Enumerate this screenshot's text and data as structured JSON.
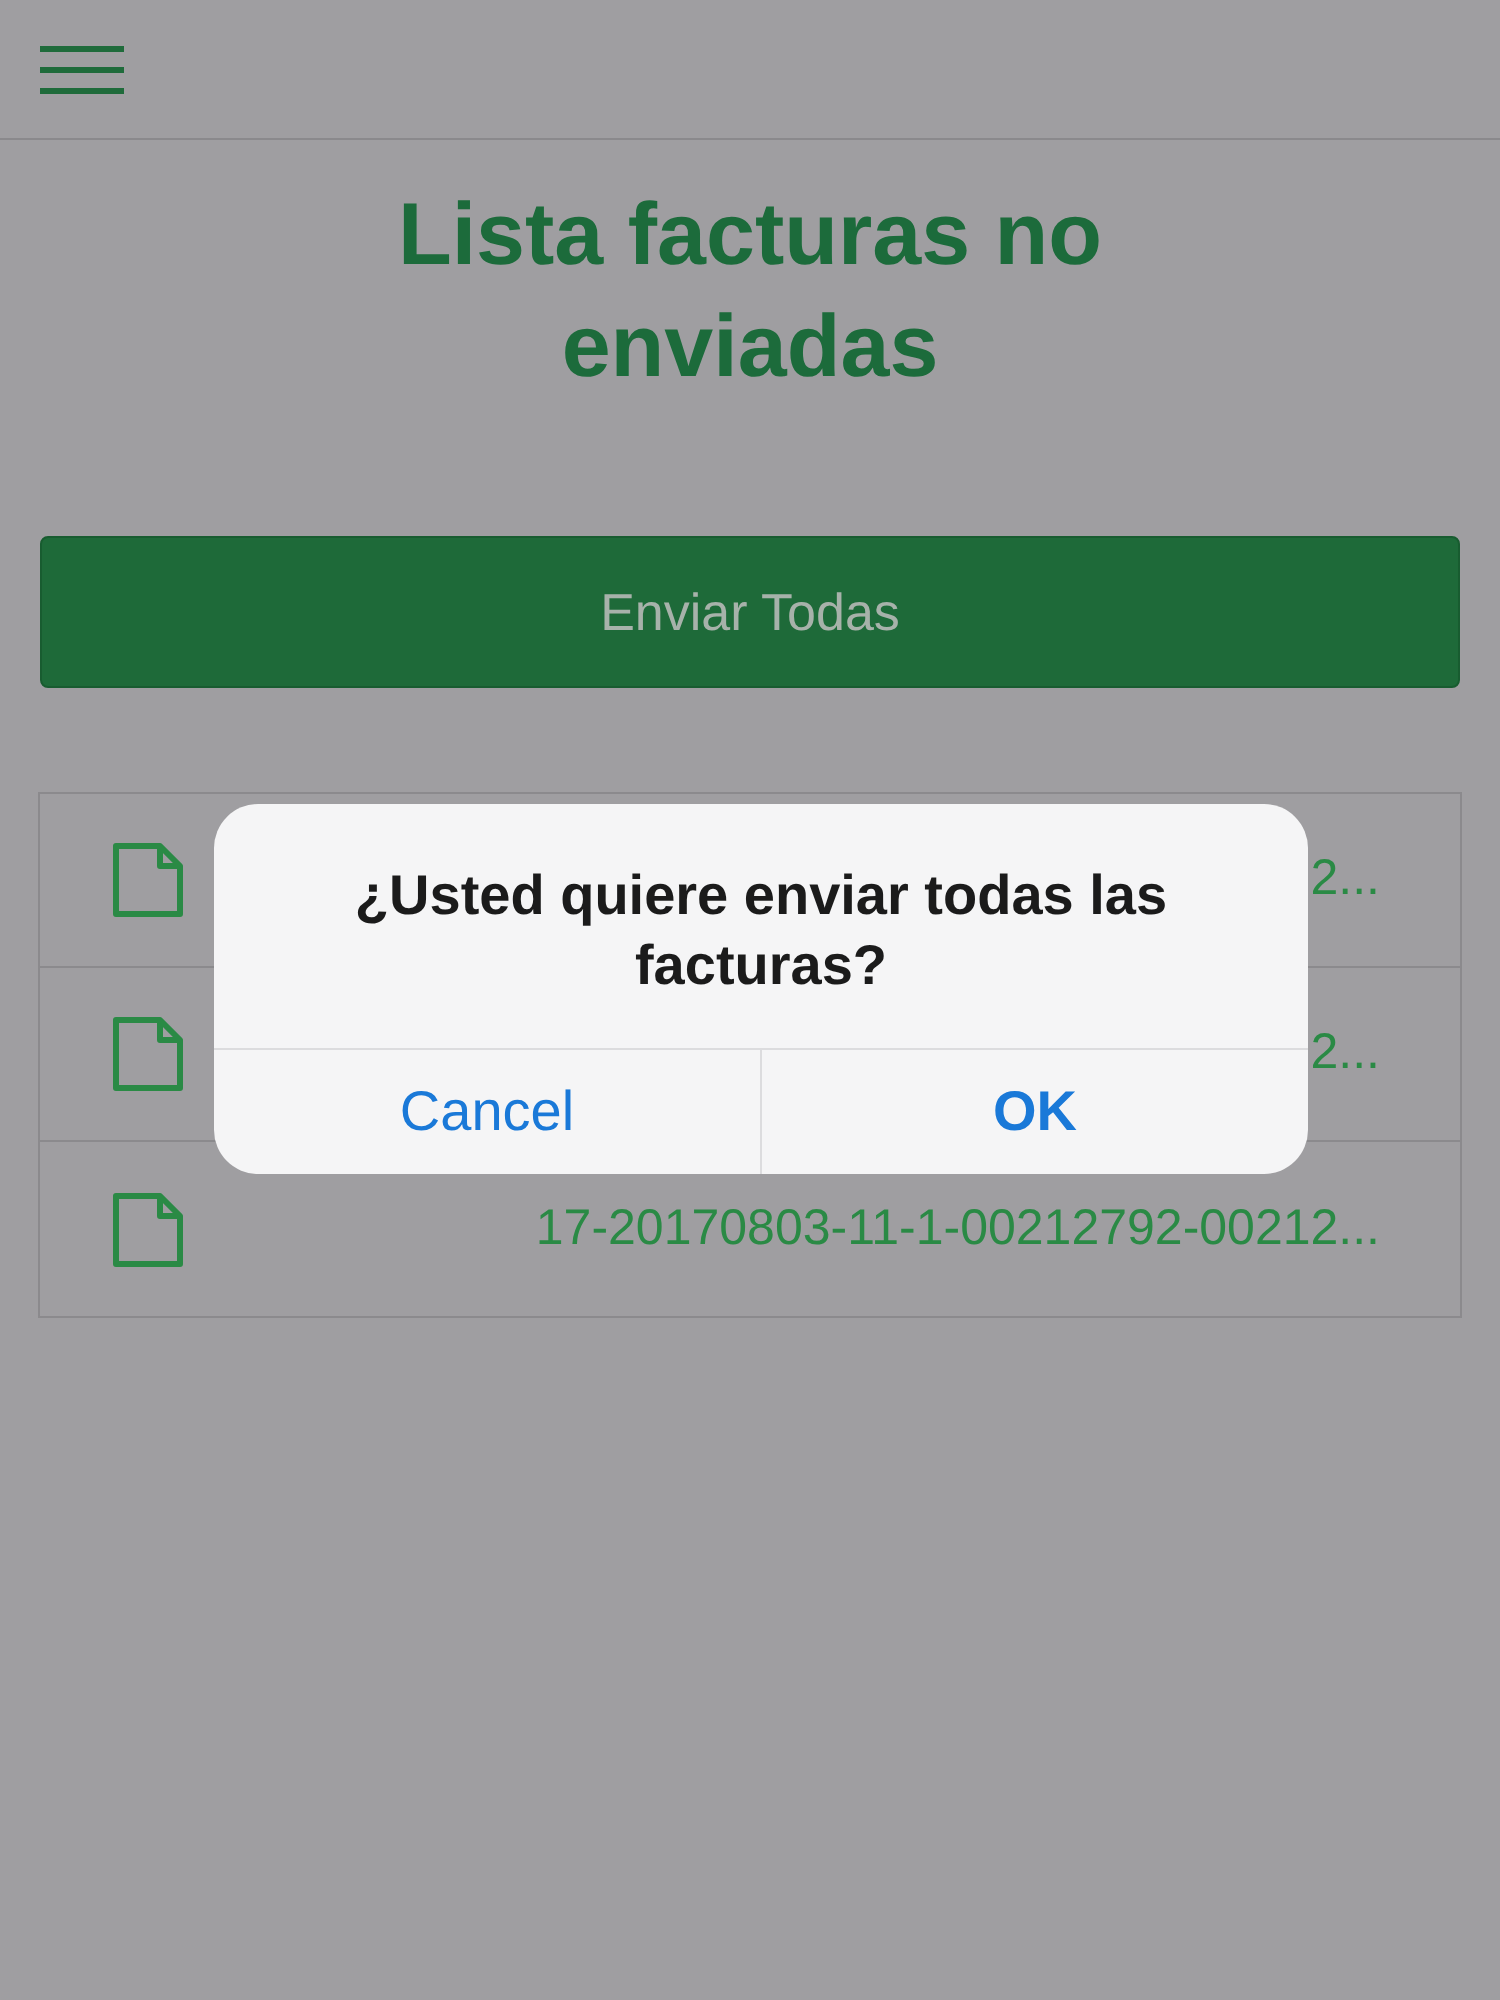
{
  "title": "Lista facturas no enviadas",
  "send_all_button": "Enviar Todas",
  "invoices": [
    {
      "name": "2..."
    },
    {
      "name": "2..."
    },
    {
      "name": "17-20170803-11-1-00212792-00212..."
    }
  ],
  "dialog": {
    "message": "¿Usted quiere enviar todas las facturas?",
    "buttons": [
      {
        "label": "Cancel",
        "kind": "cancel"
      },
      {
        "label": "OK",
        "kind": "confirm"
      }
    ]
  }
}
